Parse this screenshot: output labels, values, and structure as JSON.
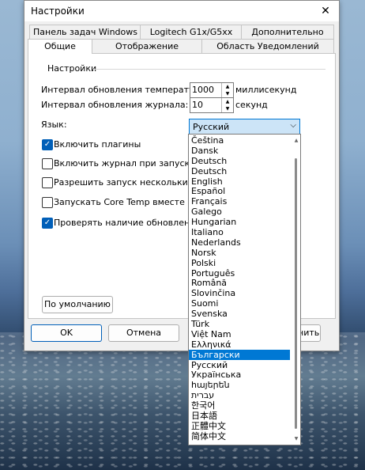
{
  "window": {
    "title": "Настройки"
  },
  "tabs": {
    "row1": [
      "Панель задач Windows",
      "Logitech G1x/G5xx",
      "Дополнительно"
    ],
    "row2": [
      "Общие",
      "Отображение",
      "Область Уведомлений"
    ],
    "active": "Общие"
  },
  "settings": {
    "group_label": "Настройки",
    "temp_interval_label": "Интервал обновления температур:",
    "temp_interval_value": "1000",
    "temp_interval_unit": "миллисекунд",
    "log_interval_label": "Интервал обновления журнала:",
    "log_interval_value": "10",
    "log_interval_unit": "секунд",
    "language_label": "Язык:",
    "language_selected": "Русский"
  },
  "checkboxes": [
    {
      "label": "Включить плагины",
      "checked": true
    },
    {
      "label": "Включить журнал при запуске",
      "checked": false
    },
    {
      "label": "Разрешить запуск нескольких ко",
      "checked": false
    },
    {
      "label": "Запускать Core Temp вместе с Wi",
      "checked": false
    },
    {
      "label": "Проверять наличие обновлений п",
      "checked": true
    }
  ],
  "buttons": {
    "defaults": "По умолчанию",
    "ok": "OK",
    "cancel": "Отмена",
    "apply": "нить"
  },
  "languages": [
    "Čeština",
    "Dansk",
    "Deutsch",
    "Deutsch",
    "English",
    "Español",
    "Français",
    "Galego",
    "Hungarian",
    "Italiano",
    "Nederlands",
    "Norsk",
    "Polski",
    "Português",
    "Română",
    "Slovinčina",
    "Suomi",
    "Svenska",
    "Türk",
    "Việt Nam",
    "Ελληνικά",
    "Български",
    "Русский",
    "Українська",
    "հայերեն",
    "עברית",
    "한국어",
    "日本語",
    "正體中文",
    "简体中文"
  ],
  "languages_highlighted": "Български",
  "icons": {
    "close": "close-icon",
    "chevron": "chevron-down-icon",
    "check": "check-icon"
  },
  "colors": {
    "accent": "#0078d4"
  }
}
